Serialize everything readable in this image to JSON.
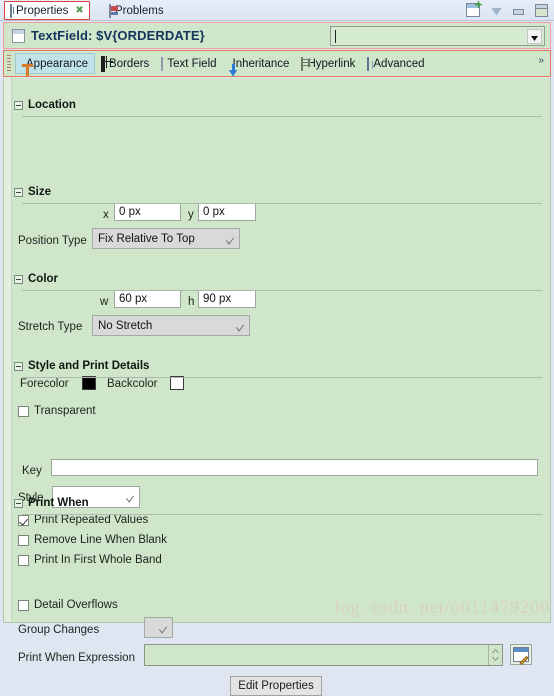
{
  "window": {
    "view_tabs": [
      {
        "label": "Properties",
        "icon": "properties-icon",
        "active": true,
        "closable": true
      },
      {
        "label": "Problems",
        "icon": "problems-icon",
        "active": false,
        "closable": false
      }
    ],
    "toolbar_icons": [
      {
        "name": "new-properties-view-icon",
        "title": "New Properties View"
      },
      {
        "name": "view-menu-icon",
        "title": "View Menu"
      },
      {
        "name": "minimize-icon",
        "title": "Minimize"
      },
      {
        "name": "maximize-icon",
        "title": "Maximize"
      }
    ]
  },
  "header": {
    "icon": "textfield-icon",
    "title": "TextField: $V{ORDERDATE}",
    "selector_value": "",
    "selector_placeholder": ""
  },
  "section_tabs": {
    "items": [
      {
        "label": "Appearance",
        "icon": "appearance-icon",
        "selected": true
      },
      {
        "label": "Borders",
        "icon": "borders-icon",
        "selected": false
      },
      {
        "label": "Text Field",
        "icon": "text-field-icon",
        "selected": false
      },
      {
        "label": "Inheritance",
        "icon": "inheritance-icon",
        "selected": false
      },
      {
        "label": "Hyperlink",
        "icon": "hyperlink-icon",
        "selected": false
      },
      {
        "label": "Advanced",
        "icon": "advanced-icon",
        "selected": false
      }
    ],
    "overflow_label": "»"
  },
  "sections": {
    "location": {
      "title": "Location",
      "x_label": "x",
      "x_value": "0 px",
      "y_label": "y",
      "y_value": "0 px",
      "position_type_label": "Position Type",
      "position_type_value": "Fix Relative To Top"
    },
    "size": {
      "title": "Size",
      "w_label": "w",
      "w_value": "60 px",
      "h_label": "h",
      "h_value": "90 px",
      "stretch_type_label": "Stretch Type",
      "stretch_type_value": "No Stretch"
    },
    "color": {
      "title": "Color",
      "forecolor_label": "Forecolor",
      "forecolor_value": "#000000",
      "backcolor_label": "Backcolor",
      "backcolor_value": "#ffffff",
      "transparent_label": "Transparent",
      "transparent_checked": false
    },
    "style_print_details": {
      "title": "Style and Print Details",
      "key_label": "Key",
      "key_value": "",
      "style_label": "Style",
      "style_value": "",
      "checkboxes": [
        {
          "label": "Print Repeated Values",
          "checked": true
        },
        {
          "label": "Remove Line When Blank",
          "checked": false
        },
        {
          "label": "Print In First Whole Band",
          "checked": false
        }
      ]
    },
    "print_when": {
      "title": "Print When",
      "detail_overflows_label": "Detail Overflows",
      "detail_overflows_checked": false,
      "group_changes_label": "Group Changes",
      "group_changes_value": "",
      "print_when_expression_label": "Print When Expression",
      "print_when_expression_value": "",
      "edit_expression_icon": "edit-expression-icon",
      "edit_properties_button": "Edit Properties"
    }
  },
  "watermark": "log. csdn. net/u011479200"
}
